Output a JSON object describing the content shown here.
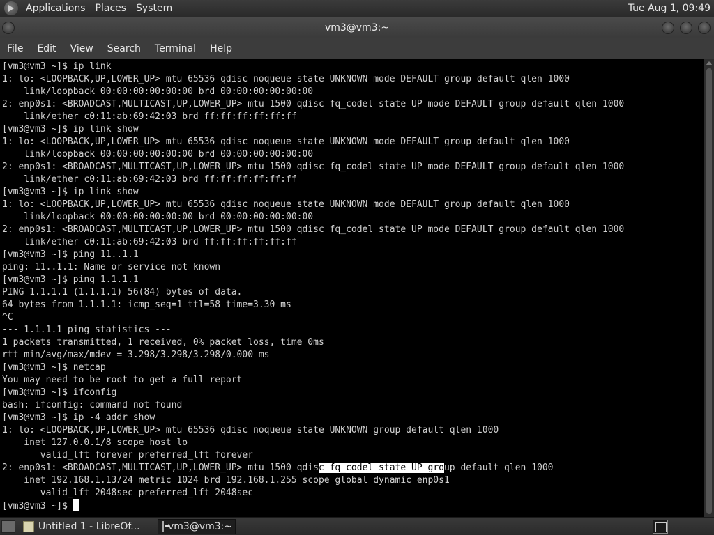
{
  "top_panel": {
    "menus": [
      "Applications",
      "Places",
      "System"
    ],
    "clock": "Tue Aug  1, 09:49"
  },
  "window": {
    "title": "vm3@vm3:~"
  },
  "menubar": [
    "File",
    "Edit",
    "View",
    "Search",
    "Terminal",
    "Help"
  ],
  "terminal": {
    "lines": [
      "[vm3@vm3 ~]$ ip link",
      "1: lo: <LOOPBACK,UP,LOWER_UP> mtu 65536 qdisc noqueue state UNKNOWN mode DEFAULT group default qlen 1000",
      "    link/loopback 00:00:00:00:00:00 brd 00:00:00:00:00:00",
      "2: enp0s1: <BROADCAST,MULTICAST,UP,LOWER_UP> mtu 1500 qdisc fq_codel state UP mode DEFAULT group default qlen 1000",
      "    link/ether c0:11:ab:69:42:03 brd ff:ff:ff:ff:ff:ff",
      "[vm3@vm3 ~]$ ip link show",
      "1: lo: <LOOPBACK,UP,LOWER_UP> mtu 65536 qdisc noqueue state UNKNOWN mode DEFAULT group default qlen 1000",
      "    link/loopback 00:00:00:00:00:00 brd 00:00:00:00:00:00",
      "2: enp0s1: <BROADCAST,MULTICAST,UP,LOWER_UP> mtu 1500 qdisc fq_codel state UP mode DEFAULT group default qlen 1000",
      "    link/ether c0:11:ab:69:42:03 brd ff:ff:ff:ff:ff:ff",
      "[vm3@vm3 ~]$ ip link show",
      "1: lo: <LOOPBACK,UP,LOWER_UP> mtu 65536 qdisc noqueue state UNKNOWN mode DEFAULT group default qlen 1000",
      "    link/loopback 00:00:00:00:00:00 brd 00:00:00:00:00:00",
      "2: enp0s1: <BROADCAST,MULTICAST,UP,LOWER_UP> mtu 1500 qdisc fq_codel state UP mode DEFAULT group default qlen 1000",
      "    link/ether c0:11:ab:69:42:03 brd ff:ff:ff:ff:ff:ff",
      "[vm3@vm3 ~]$ ping 11..1.1",
      "ping: 11..1.1: Name or service not known",
      "[vm3@vm3 ~]$ ping 1.1.1.1",
      "PING 1.1.1.1 (1.1.1.1) 56(84) bytes of data.",
      "64 bytes from 1.1.1.1: icmp_seq=1 ttl=58 time=3.30 ms",
      "^C",
      "--- 1.1.1.1 ping statistics ---",
      "1 packets transmitted, 1 received, 0% packet loss, time 0ms",
      "rtt min/avg/max/mdev = 3.298/3.298/3.298/0.000 ms",
      "[vm3@vm3 ~]$ netcap",
      "You may need to be root to get a full report",
      "[vm3@vm3 ~]$ ifconfig",
      "bash: ifconfig: command not found",
      "[vm3@vm3 ~]$ ip -4 addr show",
      "1: lo: <LOOPBACK,UP,LOWER_UP> mtu 65536 qdisc noqueue state UNKNOWN group default qlen 1000",
      "    inet 127.0.0.1/8 scope host lo",
      "       valid_lft forever preferred_lft forever",
      "2: enp0s1: <BROADCAST,MULTICAST,UP,LOWER_UP> mtu 1500 qdisc fq_codel state UP group default qlen 1000",
      "    inet 192.168.1.13/24 metric 1024 brd 192.168.1.255 scope global dynamic enp0s1",
      "       valid_lft 2048sec preferred_lft 2048sec",
      "[vm3@vm3 ~]$ "
    ],
    "selection": {
      "line": 32,
      "before": "2: enp0s1: <BROADCAST,MULTICAST,UP,LOWER_UP> mtu 1500 qdis",
      "selected": "c fq_codel state UP gro",
      "after": "up default qlen 1000"
    }
  },
  "taskbar": {
    "tasks": [
      {
        "label": "Untitled 1 - LibreOf...",
        "icon": "document-icon"
      },
      {
        "label": "vm3@vm3:~",
        "icon": "terminal-icon"
      }
    ]
  },
  "colors": {
    "terminal_bg": "#000000",
    "terminal_fg": "#d0d0d0",
    "selection_bg": "#ffffff",
    "panel_bg": "#2f2f2f"
  }
}
